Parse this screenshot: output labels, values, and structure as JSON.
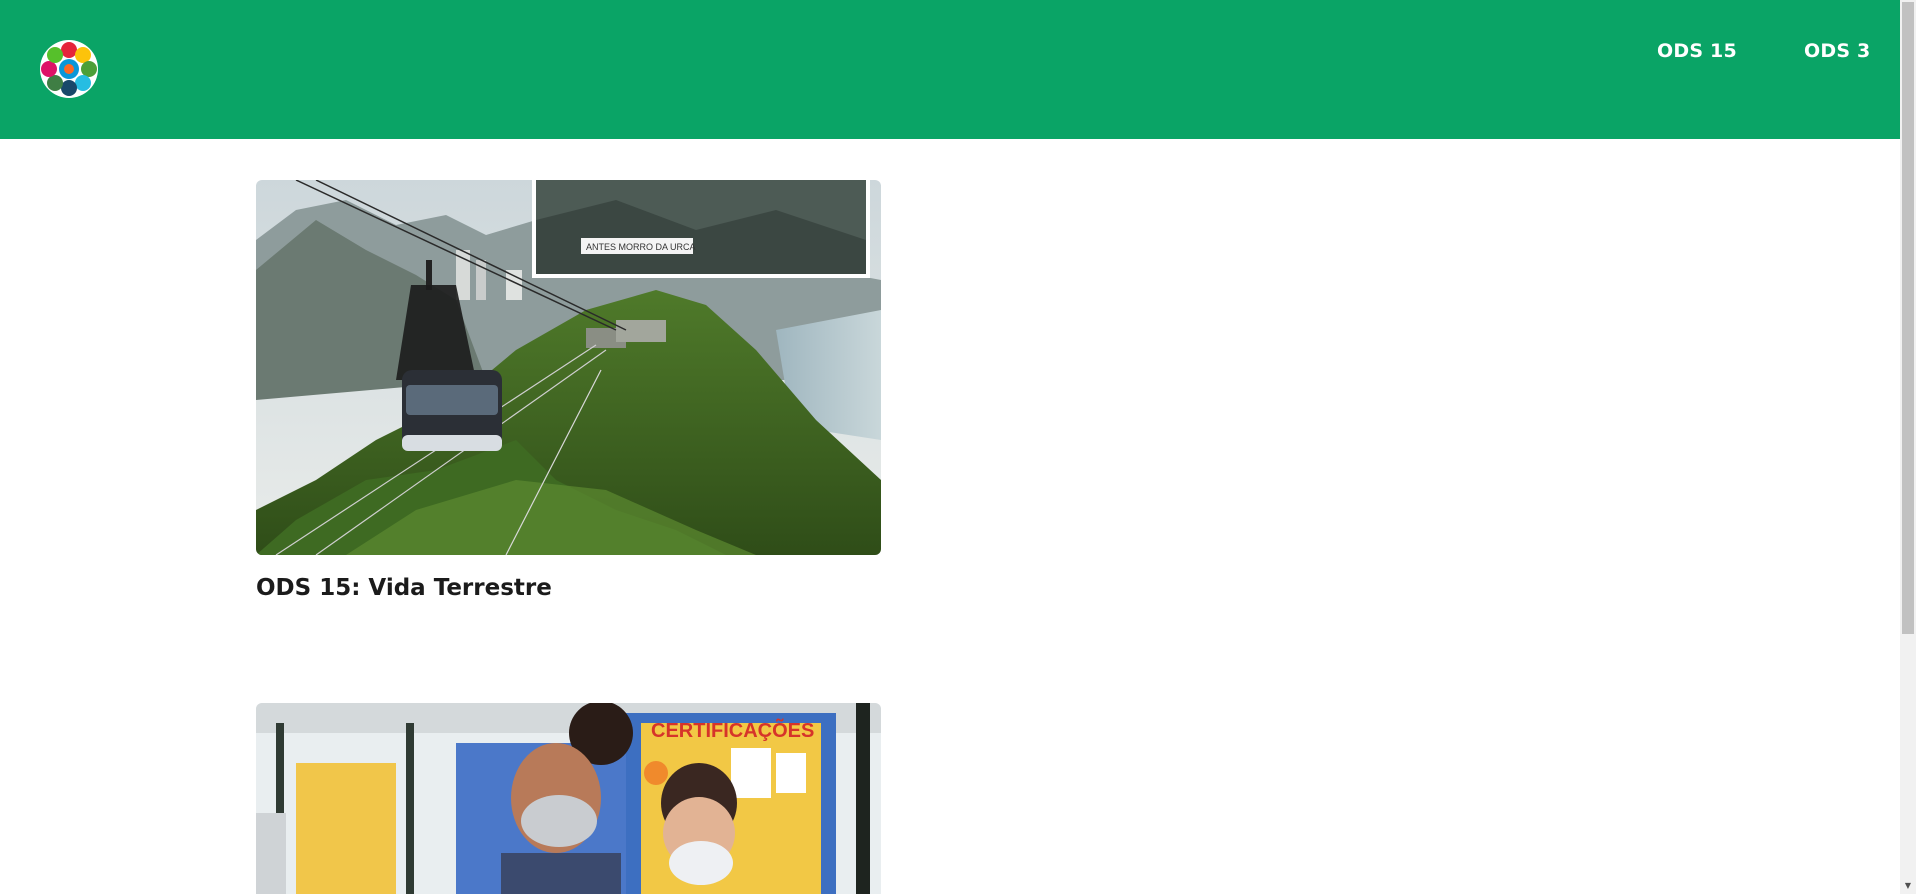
{
  "header": {
    "bg_color": "#0aa466",
    "logo_icon": "ods-wheel-logo",
    "nav": [
      {
        "label": "ODS 15"
      },
      {
        "label": "ODS 3"
      }
    ]
  },
  "cards": [
    {
      "title": "ODS 15: Vida Terrestre",
      "image": {
        "description_icon": "cable-car-photo",
        "inset_label": "ANTES MORRO DA URCA"
      }
    },
    {
      "title": "",
      "image": {
        "description_icon": "mother-child-masks-photo",
        "sign_text": "CERTIFICAÇÕES"
      }
    }
  ]
}
